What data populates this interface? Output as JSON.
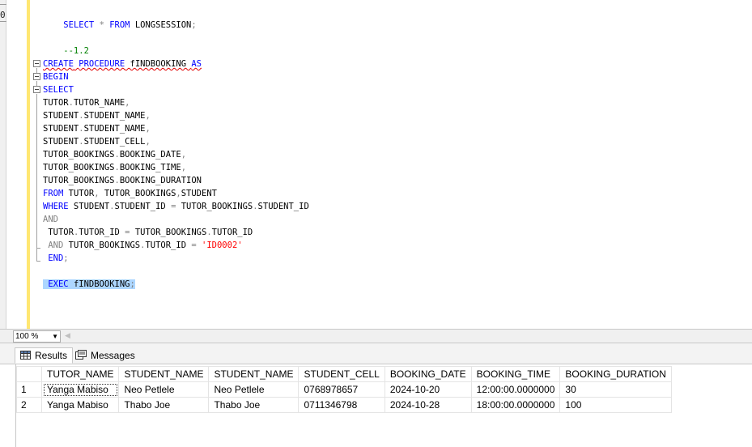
{
  "editor": {
    "left_strip_label": "0",
    "lines": [
      [
        {
          "t": "    ",
          "c": ""
        },
        {
          "t": "SELECT",
          "c": "kw"
        },
        {
          "t": " ",
          "c": ""
        },
        {
          "t": "*",
          "c": "op"
        },
        {
          "t": " ",
          "c": ""
        },
        {
          "t": "FROM",
          "c": "kw"
        },
        {
          "t": " LONGSESSION",
          "c": ""
        },
        {
          "t": ";",
          "c": "op"
        }
      ],
      [],
      [
        {
          "t": "    --1.2",
          "c": "cm"
        }
      ],
      [
        {
          "t": "CREATE",
          "c": "kw sq"
        },
        {
          "t": " ",
          "c": "sq"
        },
        {
          "t": "PROCEDURE",
          "c": "kw sq"
        },
        {
          "t": " fINDBOOKING ",
          "c": "sq"
        },
        {
          "t": "AS",
          "c": "kw sq"
        }
      ],
      [
        {
          "t": "BEGIN",
          "c": "kw"
        }
      ],
      [
        {
          "t": "SELECT",
          "c": "kw"
        }
      ],
      [
        {
          "t": "TUTOR",
          "c": ""
        },
        {
          "t": ".",
          "c": "op"
        },
        {
          "t": "TUTOR_NAME",
          "c": ""
        },
        {
          "t": ",",
          "c": "op"
        }
      ],
      [
        {
          "t": "STUDENT",
          "c": ""
        },
        {
          "t": ".",
          "c": "op"
        },
        {
          "t": "STUDENT_NAME",
          "c": ""
        },
        {
          "t": ",",
          "c": "op"
        }
      ],
      [
        {
          "t": "STUDENT",
          "c": ""
        },
        {
          "t": ".",
          "c": "op"
        },
        {
          "t": "STUDENT_NAME",
          "c": ""
        },
        {
          "t": ",",
          "c": "op"
        }
      ],
      [
        {
          "t": "STUDENT",
          "c": ""
        },
        {
          "t": ".",
          "c": "op"
        },
        {
          "t": "STUDENT_CELL",
          "c": ""
        },
        {
          "t": ",",
          "c": "op"
        }
      ],
      [
        {
          "t": "TUTOR_BOOKINGS",
          "c": ""
        },
        {
          "t": ".",
          "c": "op"
        },
        {
          "t": "BOOKING_DATE",
          "c": ""
        },
        {
          "t": ",",
          "c": "op"
        }
      ],
      [
        {
          "t": "TUTOR_BOOKINGS",
          "c": ""
        },
        {
          "t": ".",
          "c": "op"
        },
        {
          "t": "BOOKING_TIME",
          "c": ""
        },
        {
          "t": ",",
          "c": "op"
        }
      ],
      [
        {
          "t": "TUTOR_BOOKINGS",
          "c": ""
        },
        {
          "t": ".",
          "c": "op"
        },
        {
          "t": "BOOKING_DURATION",
          "c": ""
        }
      ],
      [
        {
          "t": "FROM",
          "c": "kw"
        },
        {
          "t": " TUTOR",
          "c": ""
        },
        {
          "t": ",",
          "c": "op"
        },
        {
          "t": " TUTOR_BOOKINGS",
          "c": ""
        },
        {
          "t": ",",
          "c": "op"
        },
        {
          "t": "STUDENT",
          "c": ""
        }
      ],
      [
        {
          "t": "WHERE",
          "c": "kw"
        },
        {
          "t": " STUDENT",
          "c": ""
        },
        {
          "t": ".",
          "c": "op"
        },
        {
          "t": "STUDENT_ID ",
          "c": ""
        },
        {
          "t": "=",
          "c": "op"
        },
        {
          "t": " TUTOR_BOOKINGS",
          "c": ""
        },
        {
          "t": ".",
          "c": "op"
        },
        {
          "t": "STUDENT_ID",
          "c": ""
        }
      ],
      [
        {
          "t": "AND",
          "c": "op"
        }
      ],
      [
        {
          "t": " TUTOR",
          "c": ""
        },
        {
          "t": ".",
          "c": "op"
        },
        {
          "t": "TUTOR_ID ",
          "c": ""
        },
        {
          "t": "=",
          "c": "op"
        },
        {
          "t": " TUTOR_BOOKINGS",
          "c": ""
        },
        {
          "t": ".",
          "c": "op"
        },
        {
          "t": "TUTOR_ID",
          "c": ""
        }
      ],
      [
        {
          "t": " ",
          "c": ""
        },
        {
          "t": "AND",
          "c": "op"
        },
        {
          "t": " TUTOR_BOOKINGS",
          "c": ""
        },
        {
          "t": ".",
          "c": "op"
        },
        {
          "t": "TUTOR_ID ",
          "c": ""
        },
        {
          "t": "=",
          "c": "op"
        },
        {
          "t": " ",
          "c": ""
        },
        {
          "t": "'ID0002'",
          "c": "str"
        }
      ],
      [
        {
          "t": " ",
          "c": ""
        },
        {
          "t": "END",
          "c": "kw"
        },
        {
          "t": ";",
          "c": "op"
        }
      ],
      [],
      [
        {
          "t": " ",
          "c": "sel"
        },
        {
          "t": "EXEC",
          "c": "kw sel"
        },
        {
          "t": " fINDBOOKING",
          "c": "sel"
        },
        {
          "t": ";",
          "c": "op sel"
        }
      ]
    ]
  },
  "zoom": {
    "value": "100 %"
  },
  "tabs": [
    {
      "label": "Results",
      "icon": "grid-icon",
      "active": true
    },
    {
      "label": "Messages",
      "icon": "messages-icon",
      "active": false
    }
  ],
  "results": {
    "columns": [
      "TUTOR_NAME",
      "STUDENT_NAME",
      "STUDENT_NAME",
      "STUDENT_CELL",
      "BOOKING_DATE",
      "BOOKING_TIME",
      "BOOKING_DURATION"
    ],
    "rows": [
      {
        "num": "1",
        "cells": [
          "Yanga Mabiso",
          "Neo Petlele",
          "Neo Petlele",
          "0768978657",
          "2024-10-20",
          "12:00:00.0000000",
          "30"
        ]
      },
      {
        "num": "2",
        "cells": [
          "Yanga Mabiso",
          "Thabo Joe",
          "Thabo Joe",
          "0711346798",
          "2024-10-28",
          "18:00:00.0000000",
          "100"
        ]
      }
    ]
  },
  "colors": {
    "keyword": "#0000ff",
    "comment": "#008000",
    "string": "#ff0000",
    "operator": "#808080",
    "selection": "#add6ff",
    "change_bar": "#ffe771"
  }
}
